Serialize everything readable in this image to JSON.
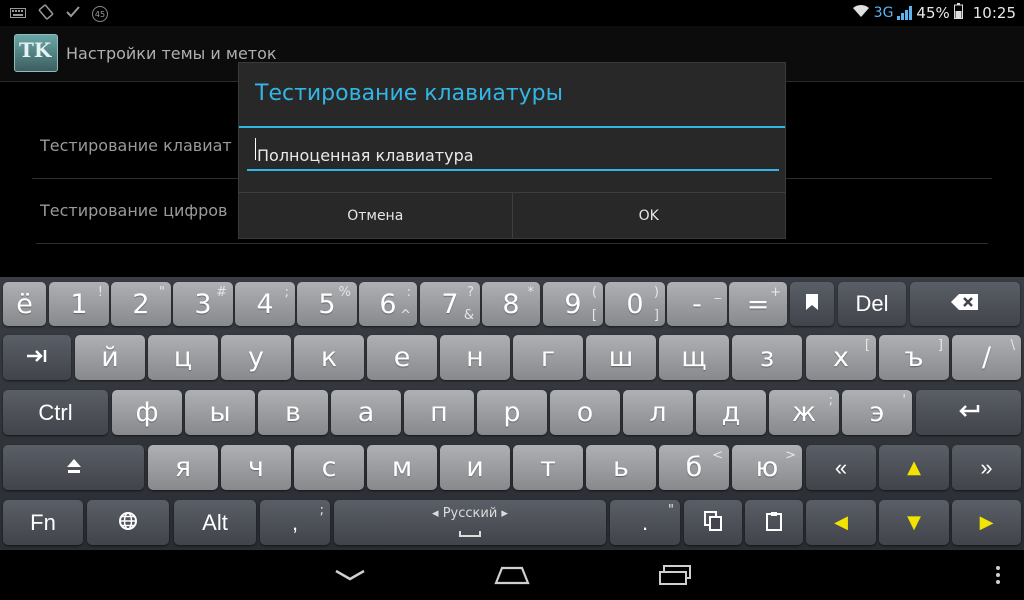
{
  "status_bar": {
    "network": "3G",
    "battery": "45%",
    "time": "10:25",
    "left_badge": "45",
    "icons": [
      "keyboard-icon",
      "screen-rotation-icon",
      "checkmark-icon",
      "badge-icon",
      "wifi-icon",
      "signal-icon",
      "battery-icon"
    ]
  },
  "app_bar": {
    "icon_text": "TK",
    "title": "Настройки темы и меток"
  },
  "settings": [
    {
      "label": "Тестирование клавиат"
    },
    {
      "label": "Тестирование цифров"
    }
  ],
  "dialog": {
    "title": "Тестирование клавиатуры",
    "input_value": "Полноценная клавиатура",
    "cancel_label": "Отмена",
    "ok_label": "OK"
  },
  "keyboard": {
    "rows": [
      [
        {
          "main": "ё"
        },
        {
          "main": "1",
          "sub": "!"
        },
        {
          "main": "2",
          "sub": "\""
        },
        {
          "main": "3",
          "sub": "#"
        },
        {
          "main": "4",
          "sub": ";"
        },
        {
          "main": "5",
          "sub": "%"
        },
        {
          "main": "6",
          "sub": ":",
          "sub2": "^"
        },
        {
          "main": "7",
          "sub": "?",
          "sub2": "&"
        },
        {
          "main": "8",
          "sub": "*"
        },
        {
          "main": "9",
          "sub": "(",
          "sub2": "["
        },
        {
          "main": "0",
          "sub": ")",
          "sub2": "]"
        },
        {
          "main": "-",
          "sub": "_"
        },
        {
          "main": "=",
          "sub": "+"
        },
        {
          "main": "⬛"
        },
        {
          "main": "Del"
        },
        {
          "main": "⌫"
        }
      ],
      [
        {
          "main": "⇥"
        },
        {
          "main": "й"
        },
        {
          "main": "ц"
        },
        {
          "main": "у"
        },
        {
          "main": "к"
        },
        {
          "main": "е"
        },
        {
          "main": "н"
        },
        {
          "main": "г"
        },
        {
          "main": "ш"
        },
        {
          "main": "щ"
        },
        {
          "main": "з"
        },
        {
          "main": "х",
          "sub": "["
        },
        {
          "main": "ъ",
          "sub": "]"
        },
        {
          "main": "/",
          "sub": "\\"
        }
      ],
      [
        {
          "main": "Ctrl"
        },
        {
          "main": "ф"
        },
        {
          "main": "ы"
        },
        {
          "main": "в"
        },
        {
          "main": "а"
        },
        {
          "main": "п"
        },
        {
          "main": "р"
        },
        {
          "main": "о"
        },
        {
          "main": "л"
        },
        {
          "main": "д"
        },
        {
          "main": "ж",
          "sub": ";"
        },
        {
          "main": "э",
          "sub": "'"
        },
        {
          "main": "↵"
        }
      ],
      [
        {
          "main": "⇧"
        },
        {
          "main": "я"
        },
        {
          "main": "ч"
        },
        {
          "main": "с"
        },
        {
          "main": "м"
        },
        {
          "main": "и"
        },
        {
          "main": "т"
        },
        {
          "main": "ь"
        },
        {
          "main": "б",
          "sub": "<"
        },
        {
          "main": "ю",
          "sub": ">"
        },
        {
          "main": "«"
        },
        {
          "main": "▲"
        },
        {
          "main": "»"
        }
      ],
      [
        {
          "main": "Fn"
        },
        {
          "main": "🌐"
        },
        {
          "main": "Alt"
        },
        {
          "main": ",",
          "sub": ";"
        },
        {
          "main": "◂ Русский ▸"
        },
        {
          "main": ".",
          "sub": "\""
        },
        {
          "main": "⧉"
        },
        {
          "main": "📋"
        },
        {
          "main": "◀"
        },
        {
          "main": "▼"
        },
        {
          "main": "▶"
        }
      ]
    ]
  },
  "nav_bar": {
    "icons": [
      "back-icon",
      "home-icon",
      "recent-apps-icon",
      "overflow-menu-icon"
    ]
  },
  "colors": {
    "accent": "#33b5e5",
    "arrow_yellow": "#f2e400"
  }
}
